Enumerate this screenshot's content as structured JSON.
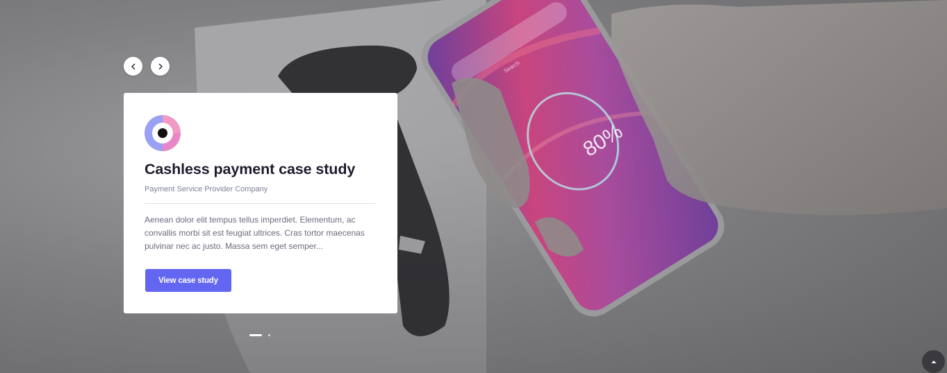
{
  "slider": {
    "prev_icon": "chevron-left-icon",
    "next_icon": "chevron-right-icon",
    "pages": 2,
    "active_page": 1
  },
  "card": {
    "logo_icon": "eye-logo-icon",
    "title": "Cashless payment case study",
    "subtitle": "Payment Service Provider Company",
    "description": "Aenean dolor elit tempus tellus imperdiet. Elementum, ac convallis morbi sit est feugiat ultrices. Cras tortor maecenas pulvinar nec ac justo. Massa sem eget semper...",
    "button_label": "View case study"
  },
  "background": {
    "phone_screen_text": "80%",
    "phone_search_placeholder": "Search"
  },
  "scroll_top": {
    "icon": "chevron-up-icon"
  },
  "colors": {
    "accent": "#6366f1",
    "title": "#1c1b2e",
    "subtitle": "#7c7f9a",
    "body": "#6b6b80"
  }
}
